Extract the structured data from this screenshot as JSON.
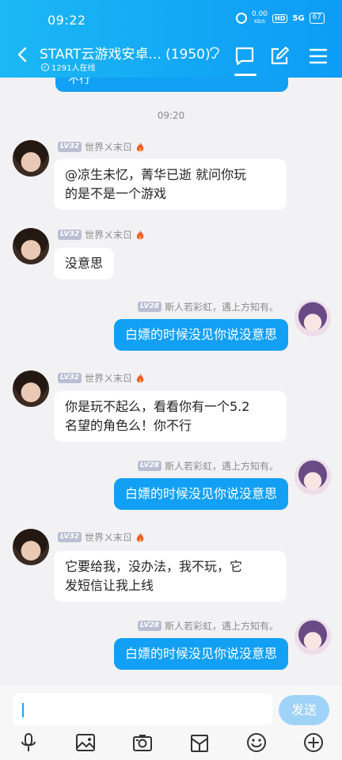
{
  "status_bar": {
    "time": "09:22",
    "speed_top": "0.00",
    "speed_unit": "KB/S",
    "hd": "HD",
    "signal": "5G",
    "battery": "67"
  },
  "header": {
    "title": "START云游戏安卓...",
    "member_count": "(1950)",
    "online_count": "1291人在线",
    "online_icon": "✓"
  },
  "partial_message": "不行",
  "timestamp": "09:20",
  "messages": [
    {
      "level": "LV32",
      "sender": "世界ㄨ末ㄖ",
      "text": [
        "@凉生未忆，菁华已逝 就问你玩",
        "的是不是一个游戏"
      ]
    },
    {
      "level": "LV32",
      "sender": "世界ㄨ末ㄖ",
      "text": [
        "没意思"
      ]
    },
    {
      "level": "LV28",
      "sender": "斯人若彩虹，遇上方知有。",
      "text": [
        "白嫖的时候没见你说没意思"
      ]
    },
    {
      "level": "LV32",
      "sender": "世界ㄨ末ㄖ",
      "text": [
        "你是玩不起么，看看你有一个5.2",
        "名望的角色么！你不行"
      ]
    },
    {
      "level": "LV28",
      "sender": "斯人若彩虹，遇上方知有。",
      "text": [
        "白嫖的时候没见你说没意思"
      ]
    },
    {
      "level": "LV32",
      "sender": "世界ㄨ末ㄖ",
      "text": [
        "它要给我，没办法，我不玩，它",
        "发短信让我上线"
      ]
    },
    {
      "level": "LV28",
      "sender": "斯人若彩虹，遇上方知有。",
      "text": [
        "白嫖的时候没见你说没意思"
      ]
    }
  ],
  "input": {
    "send_label": "发送"
  },
  "toolbar_icons": [
    "microphone-icon",
    "image-icon",
    "camera-icon",
    "gift-icon",
    "emoji-icon",
    "plus-icon"
  ],
  "colors": {
    "header": "#12a6f5",
    "bubble_out": "#12a0f4",
    "send_disabled": "#9fd3f7"
  }
}
